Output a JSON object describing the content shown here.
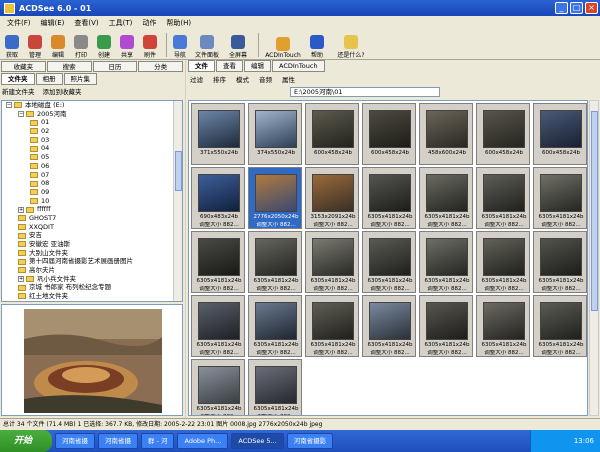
{
  "window": {
    "title": "ACDSee 6.0 - 01"
  },
  "menu": [
    "文件(F)",
    "编辑(E)",
    "查看(V)",
    "工具(T)",
    "动作",
    "帮助(H)"
  ],
  "toolbar": [
    "获取",
    "管理",
    "编辑",
    "打印",
    "创建",
    "共享",
    "刷件",
    "导航",
    "文件面板",
    "全屏幕",
    "ACDInTouch",
    "帮助",
    "还是什么?"
  ],
  "left": {
    "tabs": [
      "收藏夹",
      "搜索",
      "日历",
      "分类"
    ],
    "subtabs": [
      "文件夹",
      "相册",
      "照片集"
    ],
    "actions": [
      "新建文件夹",
      "添加到收藏夹"
    ],
    "tree": [
      {
        "label": "本地磁盘 (E:)",
        "depth": 0,
        "kind": "pm",
        "sign": "−"
      },
      {
        "label": "2005河南",
        "depth": 1,
        "kind": "pm",
        "sign": "−"
      },
      {
        "label": "01",
        "depth": 2,
        "kind": "folder"
      },
      {
        "label": "02",
        "depth": 2,
        "kind": "folder"
      },
      {
        "label": "03",
        "depth": 2,
        "kind": "folder"
      },
      {
        "label": "04",
        "depth": 2,
        "kind": "folder"
      },
      {
        "label": "05",
        "depth": 2,
        "kind": "folder"
      },
      {
        "label": "06",
        "depth": 2,
        "kind": "folder"
      },
      {
        "label": "07",
        "depth": 2,
        "kind": "folder"
      },
      {
        "label": "08",
        "depth": 2,
        "kind": "folder"
      },
      {
        "label": "09",
        "depth": 2,
        "kind": "folder"
      },
      {
        "label": "10",
        "depth": 2,
        "kind": "folder"
      },
      {
        "label": "ffffff",
        "depth": 1,
        "kind": "pm",
        "sign": "+"
      },
      {
        "label": "GHOST7",
        "depth": 1,
        "kind": "folder"
      },
      {
        "label": "XXQDIT",
        "depth": 1,
        "kind": "folder"
      },
      {
        "label": "安吉",
        "depth": 1,
        "kind": "folder"
      },
      {
        "label": "安徽宏 亚油斯",
        "depth": 1,
        "kind": "folder"
      },
      {
        "label": "大别山文件夹",
        "depth": 1,
        "kind": "folder"
      },
      {
        "label": "第十四届河南省摄影艺术展画册图片",
        "depth": 1,
        "kind": "folder"
      },
      {
        "label": "高尔夫片",
        "depth": 1,
        "kind": "folder"
      },
      {
        "label": "巩小兵文件夹",
        "depth": 1,
        "kind": "pm",
        "sign": "+"
      },
      {
        "label": "京城 书郎家 布列松纪念专题",
        "depth": 1,
        "kind": "folder"
      },
      {
        "label": "红土地文件夹",
        "depth": 1,
        "kind": "folder"
      }
    ]
  },
  "right": {
    "tabs": [
      "文件",
      "查看",
      "编辑",
      "ACDInTouch"
    ],
    "bar": [
      "过滤",
      "排序",
      "模式",
      "音频",
      "属性"
    ],
    "path": "E:\\2005河南\\01"
  },
  "thumbs": [
    {
      "l1": "371x550x24b",
      "l2": "",
      "c1": "#6d86a8",
      "c2": "#1e2a3c"
    },
    {
      "l1": "374x550x24b",
      "l2": "",
      "c1": "#9fb5cc",
      "c2": "#2f3f58"
    },
    {
      "l1": "600x458x24b",
      "l2": "",
      "c1": "#5d5a4e",
      "c2": "#22231d"
    },
    {
      "l1": "600x458x24b",
      "l2": "",
      "c1": "#4d4b40",
      "c2": "#1d1c17"
    },
    {
      "l1": "458x600x24b",
      "l2": "",
      "c1": "#6a655a",
      "c2": "#2a2822"
    },
    {
      "l1": "600x458x24b",
      "l2": "",
      "c1": "#58554a",
      "c2": "#25241f"
    },
    {
      "l1": "600x458x24b",
      "l2": "",
      "c1": "#4a5a78",
      "c2": "#1a2030"
    },
    {
      "l1": "690x483x24b",
      "l2": "调整大小 882...",
      "c1": "#3f5f9a",
      "c2": "#10203d"
    },
    {
      "l1": "2776x2050x24b",
      "l2": "调整大小 882...",
      "c1": "#b07a40",
      "c2": "#3a4a70",
      "sel": true
    },
    {
      "l1": "3153x2091x24b",
      "l2": "调整大小 882...",
      "c1": "#9a6a3a",
      "c2": "#3a2f25"
    },
    {
      "l1": "6305x4181x24b",
      "l2": "调整大小 882...",
      "c1": "#555550",
      "c2": "#1c1c1a"
    },
    {
      "l1": "6305x4181x24b",
      "l2": "调整大小 882...",
      "c1": "#6a6a62",
      "c2": "#242420"
    },
    {
      "l1": "6305x4181x24b",
      "l2": "调整大小 882...",
      "c1": "#5e5e58",
      "c2": "#20201d"
    },
    {
      "l1": "6305x4181x24b",
      "l2": "调整大小 882...",
      "c1": "#707068",
      "c2": "#262622"
    },
    {
      "l1": "6305x4181x24b",
      "l2": "调整大小 882...",
      "c1": "#4a4a45",
      "c2": "#181816"
    },
    {
      "l1": "6305x4181x24b",
      "l2": "调整大小 882...",
      "c1": "#66665f",
      "c2": "#232320"
    },
    {
      "l1": "6305x4181x24b",
      "l2": "调整大小 882...",
      "c1": "#7a7a72",
      "c2": "#2a2a26"
    },
    {
      "l1": "6305x4181x24b",
      "l2": "调整大小 882...",
      "c1": "#5a5a54",
      "c2": "#1f1f1c"
    },
    {
      "l1": "6305x4181x24b",
      "l2": "调整大小 882...",
      "c1": "#6e6e66",
      "c2": "#252522"
    },
    {
      "l1": "6305x4181x24b",
      "l2": "调整大小 882...",
      "c1": "#626258",
      "c2": "#21211d"
    },
    {
      "l1": "6305x4181x24b",
      "l2": "调整大小 882...",
      "c1": "#54544e",
      "c2": "#1c1c19"
    },
    {
      "l1": "6305x4181x24b",
      "l2": "调整大小 882...",
      "c1": "#5a5f6a",
      "c2": "#1e2026"
    },
    {
      "l1": "6305x4181x24b",
      "l2": "调整大小 882...",
      "c1": "#6a7a90",
      "c2": "#202530"
    },
    {
      "l1": "6305x4181x24b",
      "l2": "调整大小 882...",
      "c1": "#605e55",
      "c2": "#20201c"
    },
    {
      "l1": "6305x4181x24b",
      "l2": "调整大小 882...",
      "c1": "#7a8aa0",
      "c2": "#2a3038"
    },
    {
      "l1": "6305x4181x24b",
      "l2": "调整大小 882...",
      "c1": "#585650",
      "c2": "#1d1d1a"
    },
    {
      "l1": "6305x4181x24b",
      "l2": "调整大小 882...",
      "c1": "#6c6a62",
      "c2": "#242320"
    },
    {
      "l1": "6305x4181x24b",
      "l2": "调整大小 882...",
      "c1": "#5c5c56",
      "c2": "#1f1f1c"
    },
    {
      "l1": "6305x4181x24b",
      "l2": "调整大小 882...",
      "c1": "#8a909a",
      "c2": "#3a3e44"
    },
    {
      "l1": "6305x4181x24b",
      "l2": "调整大小 882...",
      "c1": "#6a6e78",
      "c2": "#262830"
    }
  ],
  "status": "总计 34 个文件 (71.4 MB)   1 已选择: 367.7 KB, 修改日期: 2005-2-22 23:01   图片 0008.jpg   2776x2050x24b jpeg",
  "taskbar": {
    "start": "开始",
    "tasks": [
      "河南省摄",
      "河南省摄",
      "群 - 河",
      "Adobe Ph...",
      "ACDSee 5...",
      "河南省摄影"
    ],
    "active_index": 4,
    "clock": "13:06"
  },
  "colors": {
    "accent": "#316ac5",
    "title": "#2a62d4"
  }
}
